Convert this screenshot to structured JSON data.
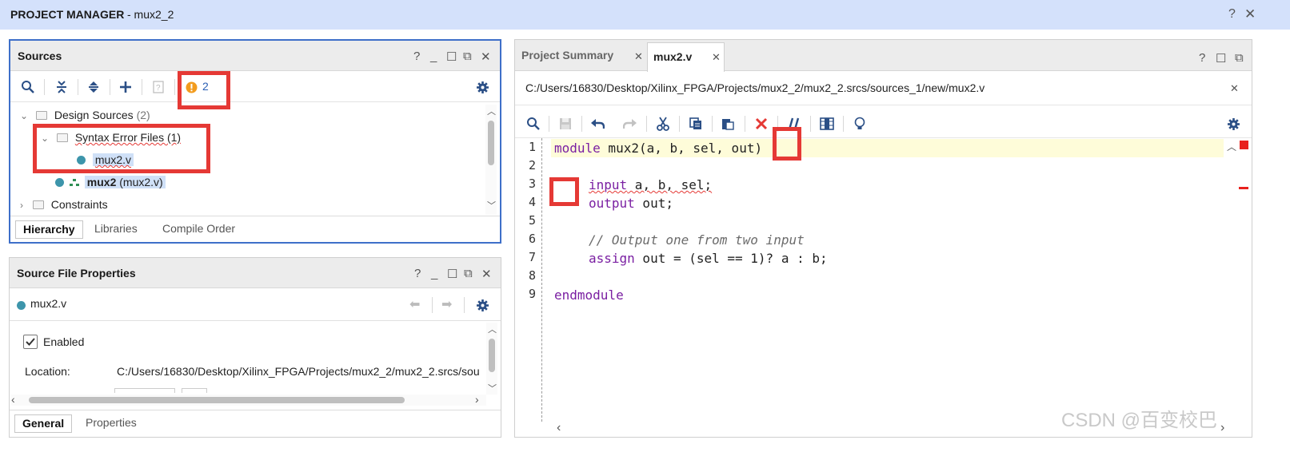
{
  "titlebar": {
    "title": "PROJECT MANAGER",
    "subtitle": "- mux2_2",
    "help": "?"
  },
  "sources": {
    "title": "Sources",
    "error_count": "2",
    "tree": {
      "design_sources": "Design Sources",
      "design_sources_count": "(2)",
      "syntax_error_files": "Syntax Error Files (1)",
      "error_file": "mux2.v",
      "module_name": "mux2",
      "module_file": "(mux2.v)",
      "constraints": "Constraints"
    },
    "tabs": [
      "Hierarchy",
      "Libraries",
      "Compile Order"
    ]
  },
  "properties": {
    "title": "Source File Properties",
    "file": "mux2.v",
    "enabled_label": "Enabled",
    "location_label": "Location:",
    "location_value": "C:/Users/16830/Desktop/Xilinx_FPGA/Projects/mux2_2/mux2_2.srcs/sou",
    "tabs": [
      "General",
      "Properties"
    ]
  },
  "editor": {
    "tabs": [
      "Project Summary",
      "mux2.v"
    ],
    "path": "C:/Users/16830/Desktop/Xilinx_FPGA/Projects/mux2_2/mux2_2.srcs/sources_1/new/mux2.v",
    "line_numbers": [
      "1",
      "2",
      "3",
      "4",
      "5",
      "6",
      "7",
      "8",
      "9"
    ],
    "code": {
      "l1_kw": "module",
      "l1_rest": " mux2(a, b, sel, out)",
      "l3_kw": "input",
      "l3_rest": " a, b, sel;",
      "l4_kw": "output",
      "l4_rest": " out;",
      "l6_comment": "// Output one from two input",
      "l7_kw": "assign",
      "l7_rest": " out = (sel == 1)? a : b;",
      "l9_kw": "endmodule"
    }
  },
  "watermark": "CSDN @百变校巴",
  "colors": {
    "accent_blue": "#3e6fc9",
    "error_red": "#e53935",
    "warning_orange": "#f29b1d",
    "keyword": "#7a1fa2"
  }
}
